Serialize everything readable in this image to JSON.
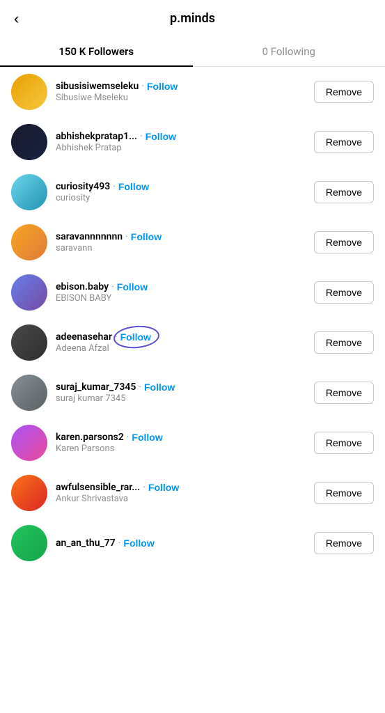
{
  "header": {
    "title": "p.minds",
    "back_label": "‹"
  },
  "tabs": [
    {
      "label": "150 K Followers",
      "active": true
    },
    {
      "label": "0 Following",
      "active": false
    }
  ],
  "followers": [
    {
      "id": 1,
      "username": "sibusisiwemseleku",
      "display_name": "Sibusiwe Mseleku",
      "follow_label": "Follow",
      "remove_label": "Remove",
      "avatar_class": "avatar-1",
      "circled": false
    },
    {
      "id": 2,
      "username": "abhishekpratap1...",
      "display_name": "Abhishek Pratap",
      "follow_label": "Follow",
      "remove_label": "Remove",
      "avatar_class": "avatar-2",
      "circled": false
    },
    {
      "id": 3,
      "username": "curiosity493",
      "display_name": "curiosity",
      "follow_label": "Follow",
      "remove_label": "Remove",
      "avatar_class": "avatar-3",
      "circled": false
    },
    {
      "id": 4,
      "username": "saravannnnnnn",
      "display_name": "saravann",
      "follow_label": "Follow",
      "remove_label": "Remove",
      "avatar_class": "avatar-4",
      "circled": false
    },
    {
      "id": 5,
      "username": "ebison.baby",
      "display_name": "EBISON BABY",
      "follow_label": "Follow",
      "remove_label": "Remove",
      "avatar_class": "avatar-5",
      "circled": false
    },
    {
      "id": 6,
      "username": "adeenasehar",
      "display_name": "Adeena Afzal",
      "follow_label": "Follow",
      "remove_label": "Remove",
      "avatar_class": "avatar-6",
      "circled": true
    },
    {
      "id": 7,
      "username": "suraj_kumar_7345",
      "display_name": "suraj kumar 7345",
      "follow_label": "Follow",
      "remove_label": "Remove",
      "avatar_class": "avatar-7",
      "circled": false
    },
    {
      "id": 8,
      "username": "karen.parsons2",
      "display_name": "Karen Parsons",
      "follow_label": "Follow",
      "remove_label": "Remove",
      "avatar_class": "avatar-8",
      "circled": false
    },
    {
      "id": 9,
      "username": "awfulsensible_rar...",
      "display_name": "Ankur Shrivastava",
      "follow_label": "Follow",
      "remove_label": "Remove",
      "avatar_class": "avatar-9",
      "circled": false
    },
    {
      "id": 10,
      "username": "an_an_thu_77",
      "display_name": "",
      "follow_label": "Follow",
      "remove_label": "Remove",
      "avatar_class": "avatar-10",
      "circled": false
    }
  ],
  "colors": {
    "follow_color": "#0095f6",
    "accent": "#000",
    "muted": "#8e8e8e"
  }
}
